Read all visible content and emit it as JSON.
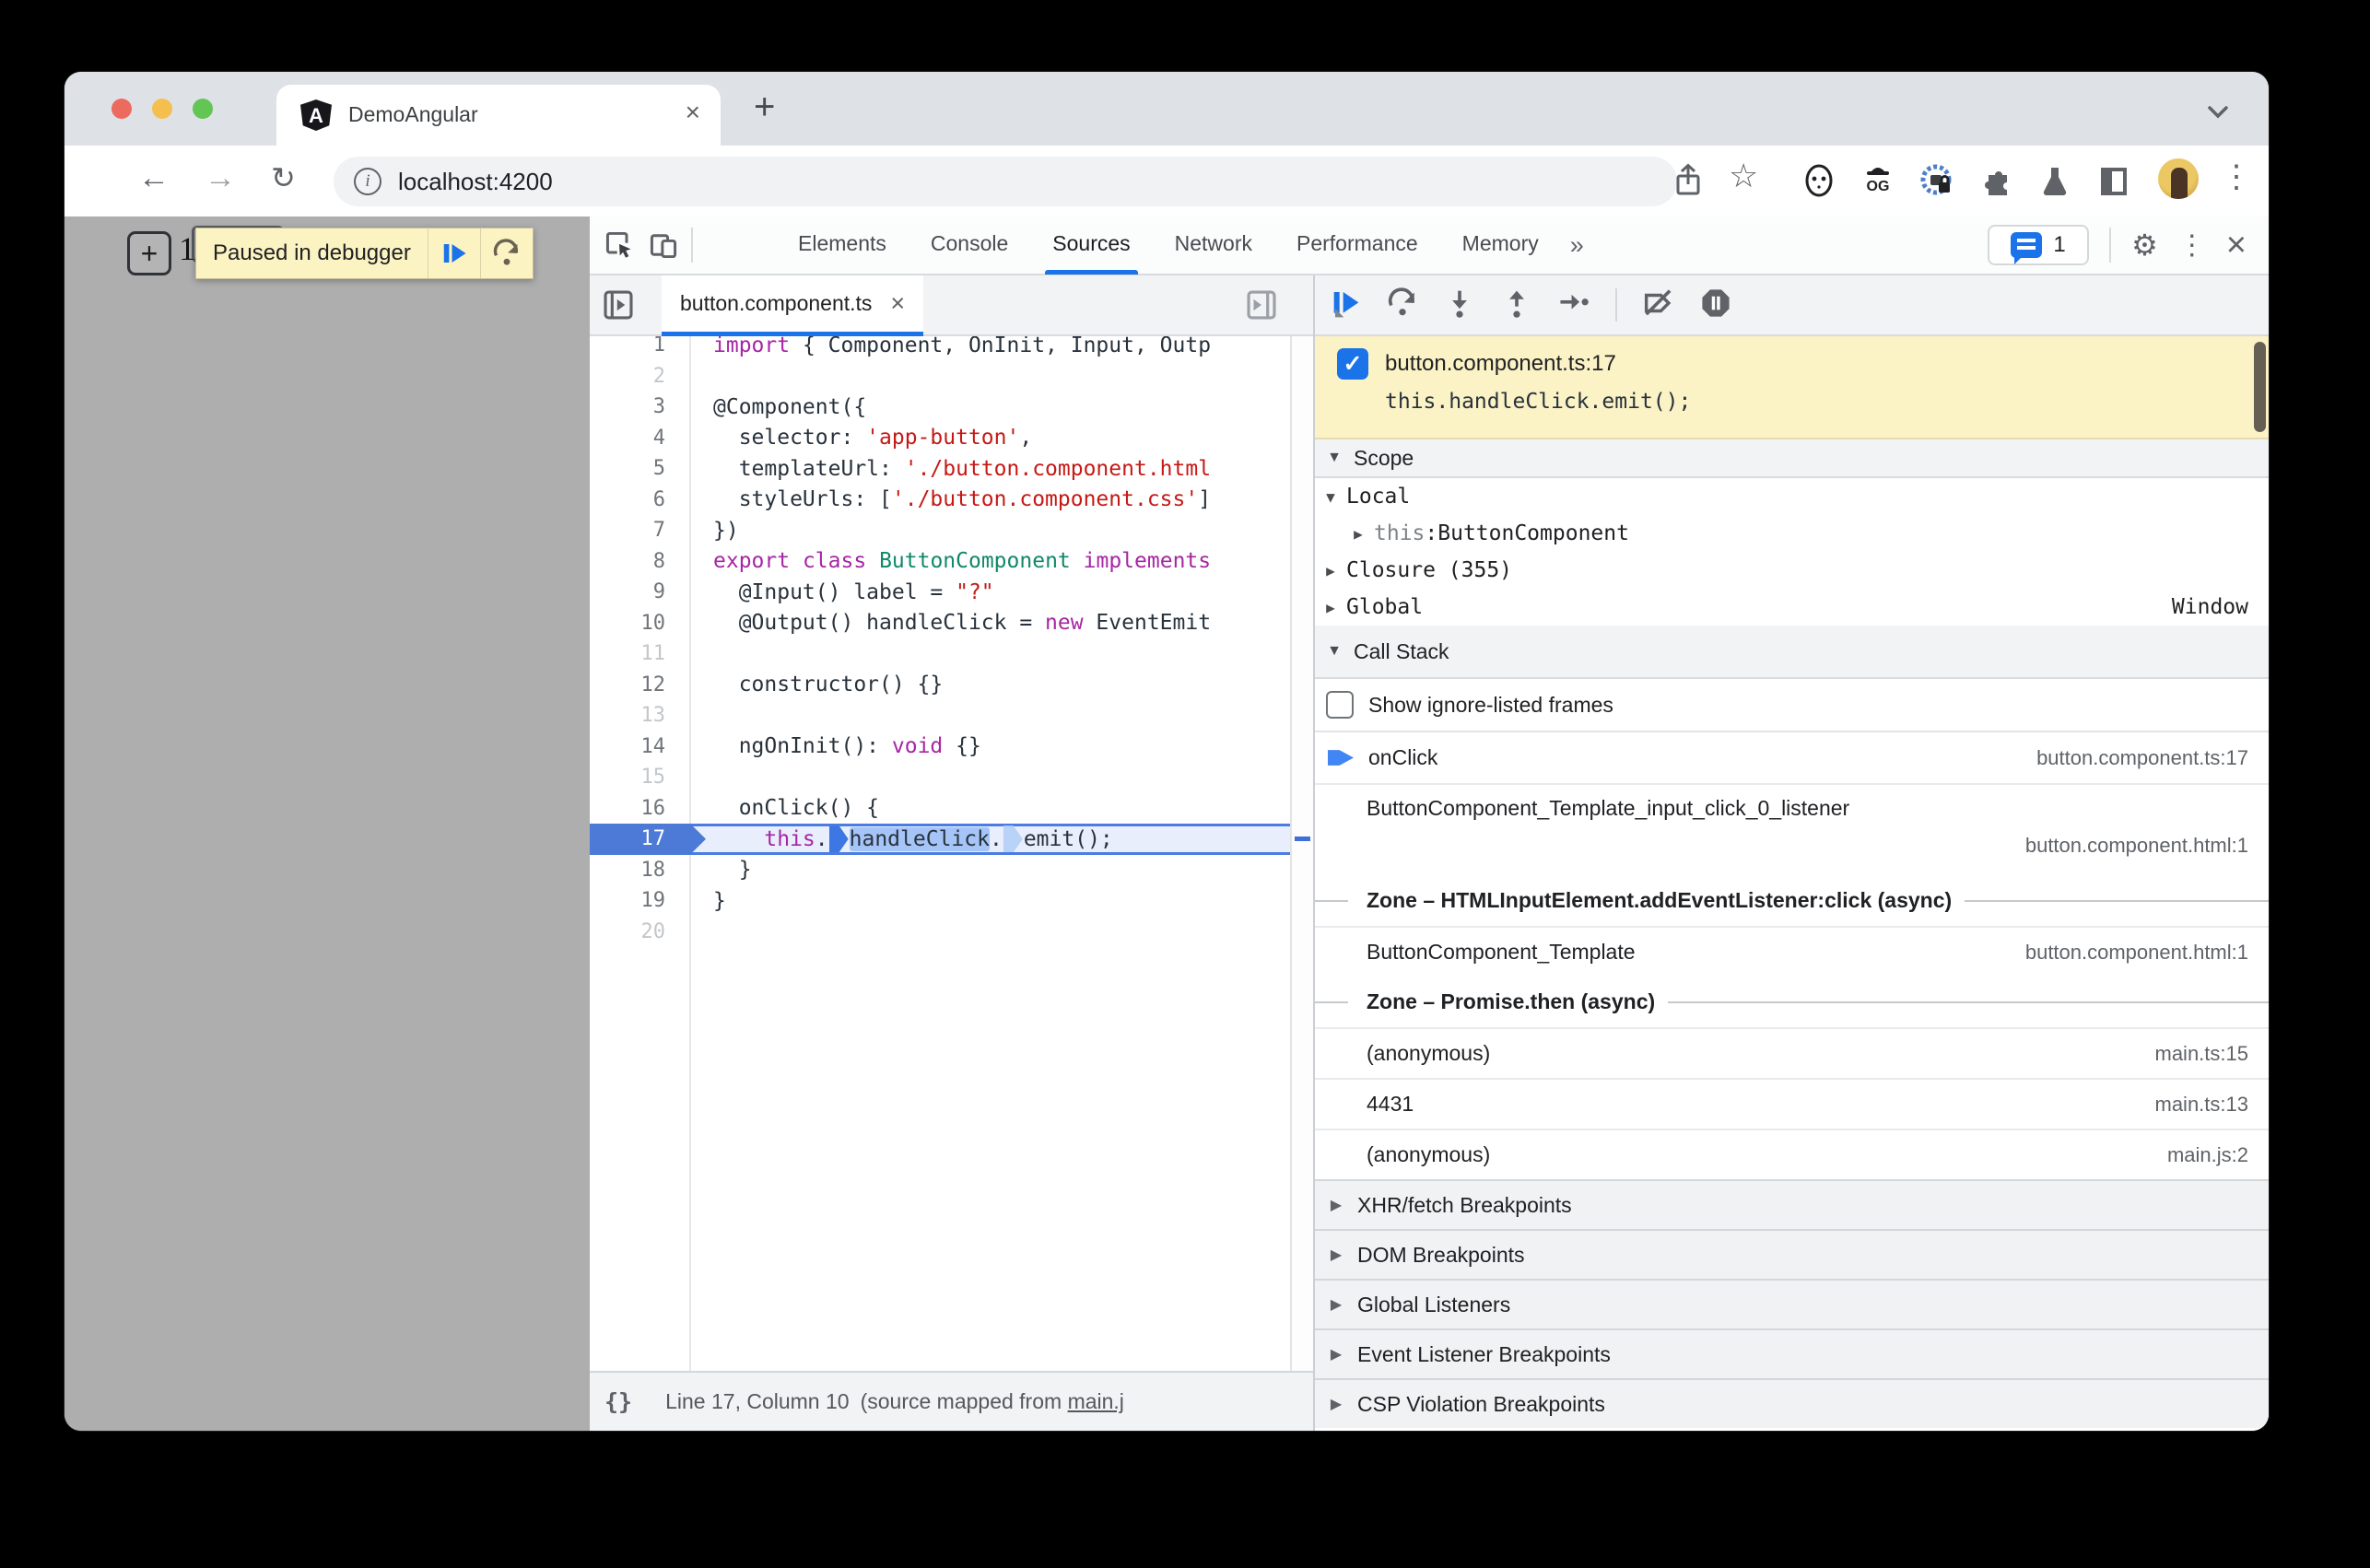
{
  "browser": {
    "tab_title": "DemoAngular",
    "favicon_letter": "A",
    "url": "localhost:4200",
    "info_glyph": "i"
  },
  "icons": {
    "back": "←",
    "forward": "→",
    "reload": "↻",
    "star": "☆",
    "kebab": "⋮",
    "more_tabs": "»",
    "gear": "⚙",
    "new_tab": "+",
    "close_tab": "×",
    "close_file": "×",
    "close_devtools": "×",
    "check": "✓",
    "tri_down": "▼",
    "tri_right": "▶",
    "braces": "{}"
  },
  "page": {
    "plus_button": "+",
    "counter": "1",
    "paused_banner": "Paused in debugger"
  },
  "devtools": {
    "main_tabs": [
      "Elements",
      "Console",
      "Sources",
      "Network",
      "Performance",
      "Memory"
    ],
    "active_tab": "Sources",
    "issues_count": "1",
    "file_tab": "button.component.ts",
    "status_bar": {
      "position": "Line 17, Column 10",
      "mapped_prefix": "(source mapped from ",
      "mapped_link": "main.j"
    }
  },
  "editor": {
    "lines": [
      {
        "n": "1",
        "tokens": [
          [
            "k",
            "import"
          ],
          [
            "p",
            " { Component, OnInit, Input, Outp"
          ]
        ]
      },
      {
        "n": "2",
        "tokens": []
      },
      {
        "n": "3",
        "tokens": [
          [
            "p",
            "@Component({"
          ]
        ]
      },
      {
        "n": "4",
        "tokens": [
          [
            "p",
            "  selector: "
          ],
          [
            "s",
            "'app-button'"
          ],
          [
            "p",
            ","
          ]
        ]
      },
      {
        "n": "5",
        "tokens": [
          [
            "p",
            "  templateUrl: "
          ],
          [
            "s",
            "'./button.component.html"
          ]
        ]
      },
      {
        "n": "6",
        "tokens": [
          [
            "p",
            "  styleUrls: ["
          ],
          [
            "s",
            "'./button.component.css'"
          ],
          [
            "p",
            "]"
          ]
        ]
      },
      {
        "n": "7",
        "tokens": [
          [
            "p",
            "})"
          ]
        ]
      },
      {
        "n": "8",
        "tokens": [
          [
            "k",
            "export"
          ],
          [
            "p",
            " "
          ],
          [
            "k",
            "class"
          ],
          [
            "p",
            " "
          ],
          [
            "c",
            "ButtonComponent"
          ],
          [
            "p",
            " "
          ],
          [
            "k",
            "implements"
          ]
        ]
      },
      {
        "n": "9",
        "tokens": [
          [
            "p",
            "  @Input() label = "
          ],
          [
            "s",
            "\"?\""
          ]
        ]
      },
      {
        "n": "10",
        "tokens": [
          [
            "p",
            "  @Output() handleClick = "
          ],
          [
            "k",
            "new"
          ],
          [
            "p",
            " EventEmit"
          ]
        ]
      },
      {
        "n": "11",
        "tokens": []
      },
      {
        "n": "12",
        "tokens": [
          [
            "p",
            "  constructor() {}"
          ]
        ]
      },
      {
        "n": "13",
        "tokens": []
      },
      {
        "n": "14",
        "tokens": [
          [
            "p",
            "  ngOnInit(): "
          ],
          [
            "k",
            "void"
          ],
          [
            "p",
            " {}"
          ]
        ]
      },
      {
        "n": "15",
        "tokens": []
      },
      {
        "n": "16",
        "tokens": [
          [
            "p",
            "  onClick() {"
          ]
        ]
      },
      {
        "n": "17",
        "highlight": true,
        "tokens": [
          [
            "p",
            "    "
          ],
          [
            "k",
            "this"
          ],
          [
            "p",
            "."
          ],
          [
            "ms",
            ""
          ],
          [
            "sel",
            "handleClick"
          ],
          [
            "p",
            "."
          ],
          [
            "mh",
            ""
          ],
          [
            "p",
            "emit();"
          ]
        ]
      },
      {
        "n": "18",
        "tokens": [
          [
            "p",
            "  }"
          ]
        ]
      },
      {
        "n": "19",
        "tokens": [
          [
            "p",
            "}"
          ]
        ]
      },
      {
        "n": "20",
        "tokens": []
      }
    ]
  },
  "sidebar": {
    "paused_message": {
      "file": "button.component.ts:17",
      "code": "this.handleClick.emit();"
    },
    "scope": {
      "title": "Scope",
      "rows": [
        {
          "arrow": "▼",
          "label": "Local"
        },
        {
          "arrow": "▶",
          "indent": true,
          "var": "this",
          "sep": ": ",
          "value": "ButtonComponent"
        },
        {
          "arrow": "▶",
          "label": "Closure (355)"
        },
        {
          "arrow": "▶",
          "label": "Global",
          "right": "Window"
        }
      ]
    },
    "call_stack": {
      "title": "Call Stack",
      "checkbox_label": "Show ignore-listed frames",
      "frames": [
        {
          "kind": "frame",
          "current": true,
          "name": "onClick",
          "loc": "button.component.ts:17"
        },
        {
          "kind": "frame",
          "wrap": true,
          "name": "ButtonComponent_Template_input_click_0_listener",
          "loc": "button.component.html:1"
        },
        {
          "kind": "async",
          "text": "Zone – HTMLInputElement.addEventListener:click (async)"
        },
        {
          "kind": "frame",
          "name": "ButtonComponent_Template",
          "loc": "button.component.html:1"
        },
        {
          "kind": "async",
          "text": "Zone – Promise.then (async)"
        },
        {
          "kind": "frame",
          "name": "(anonymous)",
          "loc": "main.ts:15"
        },
        {
          "kind": "frame",
          "name": "4431",
          "loc": "main.ts:13"
        },
        {
          "kind": "frame",
          "name": "(anonymous)",
          "loc": "main.js:2"
        }
      ]
    },
    "sections": [
      "XHR/fetch Breakpoints",
      "DOM Breakpoints",
      "Global Listeners",
      "Event Listener Breakpoints",
      "CSP Violation Breakpoints"
    ]
  },
  "colors": {
    "accent": "#1a73e8",
    "paused_bg": "#fbf2c5",
    "exec_gutter": "#4d7ad6",
    "keyword": "#a626a4",
    "string": "#c41a16",
    "class_name": "#0f8968"
  }
}
